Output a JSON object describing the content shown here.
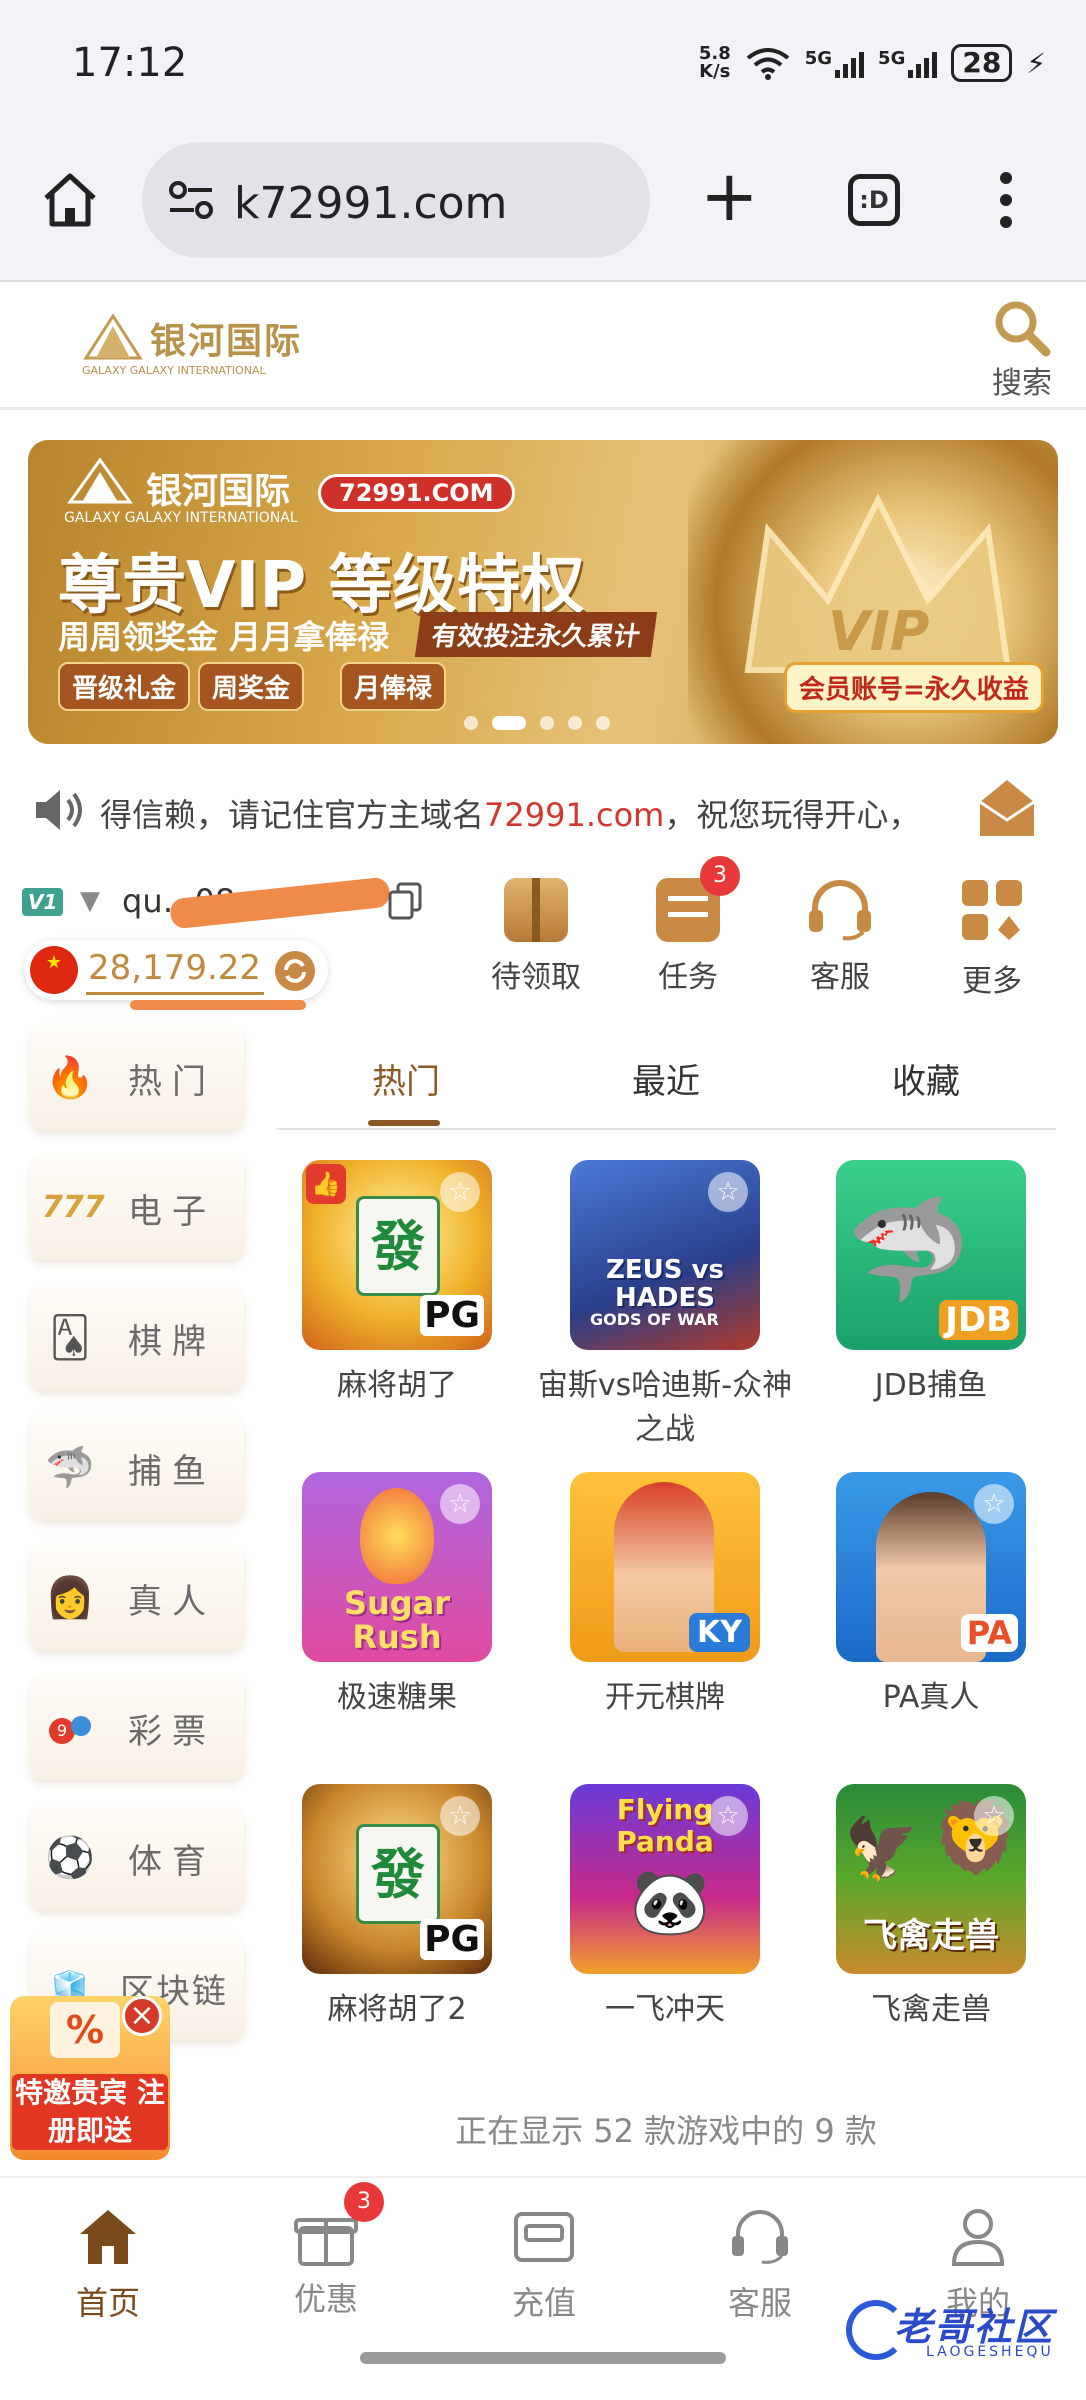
{
  "status_bar": {
    "time": "17:12",
    "net_speed_value": "5.8",
    "net_speed_unit": "K/s",
    "battery": "28"
  },
  "browser": {
    "url": "k72991.com",
    "tab_label": ":D"
  },
  "header": {
    "logo_text": "银河国际",
    "logo_sub": "GALAXY  GALAXY INTERNATIONAL",
    "search_label": "搜索"
  },
  "banner": {
    "brand": "银河国际",
    "brand_sub": "GALAXY  GALAXY INTERNATIONAL",
    "domain_badge": "72991.COM",
    "headline": "尊贵VIP 等级特权",
    "subline": "周周领奖金 月月拿俸禄",
    "ribbon": "有效投注永久累计",
    "pills": [
      "晋级礼金",
      "周奖金",
      "月俸禄"
    ],
    "right_badge": "会员账号=永久收益",
    "crown_text": "VIP"
  },
  "notice": {
    "text_before": "得信赖，请记住官方主域名",
    "domain": "72991.com",
    "text_after": "，祝您玩得开心，"
  },
  "user": {
    "level": "V1",
    "username": "qu…08…",
    "balance": "28,179.22"
  },
  "quick_actions": [
    {
      "label": "待领取"
    },
    {
      "label": "任务",
      "badge": "3"
    },
    {
      "label": "客服"
    },
    {
      "label": "更多"
    }
  ],
  "sidebar": [
    {
      "label": "热门"
    },
    {
      "label": "电子"
    },
    {
      "label": "棋牌"
    },
    {
      "label": "捕鱼"
    },
    {
      "label": "真人"
    },
    {
      "label": "彩票"
    },
    {
      "label": "体育"
    },
    {
      "label": "区块链"
    }
  ],
  "tabs": [
    {
      "label": "热门"
    },
    {
      "label": "最近"
    },
    {
      "label": "收藏"
    }
  ],
  "games": [
    {
      "name": "麻将胡了",
      "mark": "PG",
      "tile": "發"
    },
    {
      "name": "宙斯vs哈迪斯-众神之战",
      "mark": "ZEUS vs HADES",
      "sub": "GODS OF WAR"
    },
    {
      "name": "JDB捕鱼",
      "mark": "JDB"
    },
    {
      "name": "极速糖果",
      "mark": "Sugar Rush"
    },
    {
      "name": "开元棋牌",
      "mark": "KY"
    },
    {
      "name": "PA真人",
      "mark": "PA"
    },
    {
      "name": "麻将胡了2",
      "mark": "PG",
      "tile": "發"
    },
    {
      "name": "一飞冲天",
      "mark": "Flying Panda"
    },
    {
      "name": "飞禽走兽",
      "mark": "飞禽走兽"
    }
  ],
  "games_footer": "正在显示 52 款游戏中的 9 款",
  "promo": {
    "text": "特邀贵宾 注册即送",
    "close": "×"
  },
  "bottom_nav": [
    {
      "label": "首页",
      "active": true
    },
    {
      "label": "优惠",
      "badge": "3"
    },
    {
      "label": "充值"
    },
    {
      "label": "客服"
    },
    {
      "label": "我的"
    }
  ],
  "watermark": {
    "text": "老哥社区",
    "sub": "LAOGESHEQU"
  }
}
